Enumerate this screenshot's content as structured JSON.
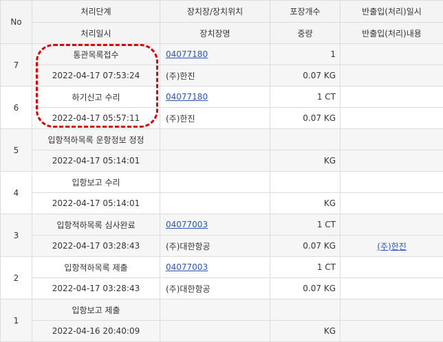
{
  "header": {
    "no": "No",
    "row1": [
      "처리단계",
      "장치장/장치위치",
      "포장개수",
      "반출입(처리)일시"
    ],
    "row2": [
      "처리일시",
      "장치장명",
      "중량",
      "반출입(처리)내용"
    ]
  },
  "rows": [
    {
      "no": "7",
      "step": "통관목록접수",
      "datetime": "2022-04-17 07:53:24",
      "code": "04077180",
      "name": "(주)한진",
      "count": "1",
      "weight": "0.07 KG",
      "io_time": "",
      "io_desc": ""
    },
    {
      "no": "6",
      "step": "하기신고 수리",
      "datetime": "2022-04-17 05:57:11",
      "code": "04077180",
      "name": "(주)한진",
      "count": "1 CT",
      "weight": "0.07 KG",
      "io_time": "",
      "io_desc": ""
    },
    {
      "no": "5",
      "step": "입항적하목록 운항정보 정정",
      "datetime": "2022-04-17 05:14:01",
      "code": "",
      "name": "",
      "count": "",
      "weight": "KG",
      "io_time": "",
      "io_desc": ""
    },
    {
      "no": "4",
      "step": "입항보고 수리",
      "datetime": "2022-04-17 05:14:01",
      "code": "",
      "name": "",
      "count": "",
      "weight": "KG",
      "io_time": "",
      "io_desc": ""
    },
    {
      "no": "3",
      "step": "입항적하목록 심사완료",
      "datetime": "2022-04-17 03:28:43",
      "code": "04077003",
      "name": "(주)대한항공",
      "count": "1 CT",
      "weight": "0.07 KG",
      "io_time": "",
      "io_desc": "(주)한진"
    },
    {
      "no": "2",
      "step": "입항적하목록 제출",
      "datetime": "2022-04-17 03:28:43",
      "code": "04077003",
      "name": "(주)대한항공",
      "count": "1 CT",
      "weight": "0.07 KG",
      "io_time": "",
      "io_desc": ""
    },
    {
      "no": "1",
      "step": "입항보고 제출",
      "datetime": "2022-04-16 20:40:09",
      "code": "",
      "name": "",
      "count": "",
      "weight": "KG",
      "io_time": "",
      "io_desc": ""
    }
  ]
}
